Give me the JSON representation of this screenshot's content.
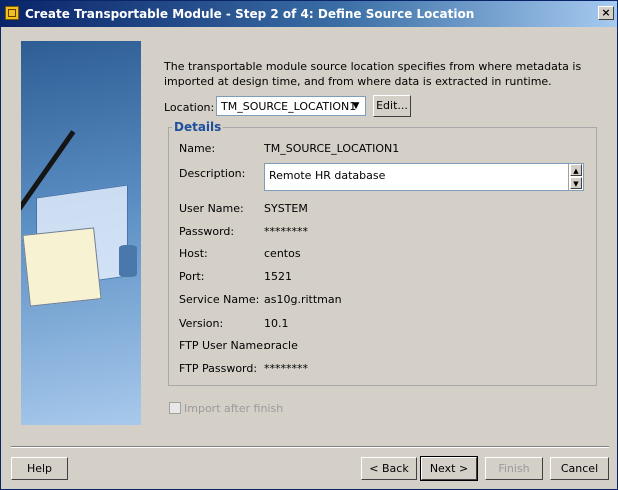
{
  "window": {
    "title": "Create Transportable Module - Step 2 of 4: Define Source Location",
    "close_label": "×"
  },
  "description_text": "The transportable module source location specifies from where metadata is imported at design time, and from where data is extracted in runtime.",
  "location": {
    "label": "Location:",
    "value": "TM_SOURCE_LOCATION1",
    "arrow": "▼",
    "edit_label": "Edit..."
  },
  "details": {
    "title": "Details",
    "rows": [
      {
        "label": "Name:",
        "value": "TM_SOURCE_LOCATION1"
      },
      {
        "label": "Description:",
        "value": "Remote HR database"
      },
      {
        "label": "User Name:",
        "value": "SYSTEM"
      },
      {
        "label": "Password:",
        "value": "********"
      },
      {
        "label": "Host:",
        "value": "centos"
      },
      {
        "label": "Port:",
        "value": "1521"
      },
      {
        "label": "Service Name:",
        "value": "as10g.rittman"
      },
      {
        "label": "Version:",
        "value": "10.1"
      },
      {
        "label": "FTP User Name:",
        "value": "oracle"
      },
      {
        "label": "FTP Password:",
        "value": "********"
      }
    ],
    "scroll_up": "▲",
    "scroll_down": "▼"
  },
  "import_after_finish": {
    "label": "Import after finish"
  },
  "buttons": {
    "help": "Help",
    "back": "< Back",
    "next": "Next >",
    "finish": "Finish",
    "cancel": "Cancel"
  }
}
